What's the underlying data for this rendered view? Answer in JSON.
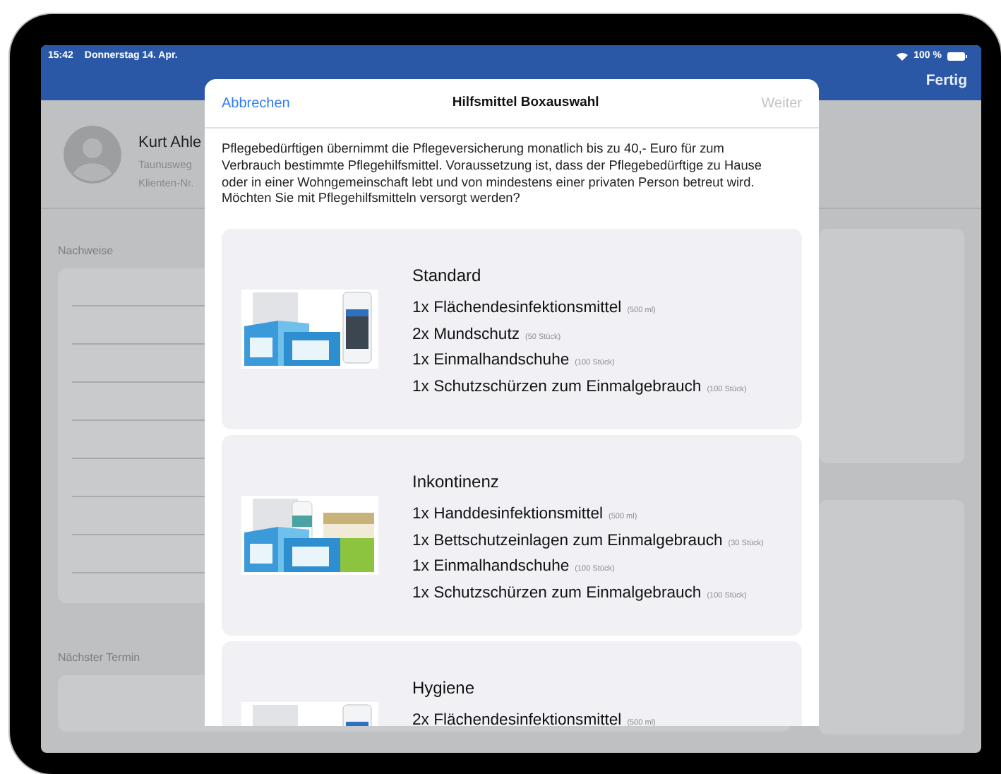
{
  "status_bar": {
    "time": "15:42",
    "date": "Donnerstag 14. Apr.",
    "battery": "100 %"
  },
  "nav_bar": {
    "done_button": "Fertig"
  },
  "client": {
    "name": "Kurt Ahle",
    "address": "Taunusweg",
    "client_number": "Klienten-Nr."
  },
  "sections": [
    {
      "title": "Nachweise",
      "kind": "list"
    },
    {
      "title": "Nächster Termin",
      "kind": "single"
    }
  ],
  "modal": {
    "cancel": "Abbrechen",
    "title": "Hilfsmittel Boxauswahl",
    "next": {
      "label": "Weiter",
      "disabled": true
    },
    "intro": "Pflegebedürftigen übernimmt die Pflegeversicherung monatlich bis zu 40,- Euro für zum Verbrauch bestimmte Pflegehilfsmittel. Voraussetzung ist, dass der Pflegebedürftige zu Hause oder in einer Wohngemeinschaft lebt und von mindestens einer privaten Person betreut wird. Möchten Sie mit Pflegehilfsmitteln versorgt werden?",
    "boxes": [
      {
        "title": "Standard",
        "items": [
          {
            "text": "1x Flächendesinfektionsmittel",
            "amount": "(500 ml)"
          },
          {
            "text": "2x Mundschutz",
            "amount": "(50 Stück)"
          },
          {
            "text": "1x Einmalhandschuhe",
            "amount": "(100 Stück)"
          },
          {
            "text": "1x Schutzschürzen zum Einmalgebrauch",
            "amount": "(100 Stück)"
          }
        ]
      },
      {
        "title": "Inkontinenz",
        "items": [
          {
            "text": "1x Handdesinfektionsmittel",
            "amount": "(500 ml)"
          },
          {
            "text": "1x Bettschutzeinlagen zum Einmalgebrauch",
            "amount": "(30 Stück)"
          },
          {
            "text": "1x Einmalhandschuhe",
            "amount": "(100 Stück)"
          },
          {
            "text": "1x Schutzschürzen zum Einmalgebrauch",
            "amount": "(100 Stück)"
          }
        ]
      },
      {
        "title": "Hygiene",
        "items": [
          {
            "text": "2x Flächendesinfektionsmittel",
            "amount": "(500 ml)"
          }
        ]
      }
    ]
  }
}
